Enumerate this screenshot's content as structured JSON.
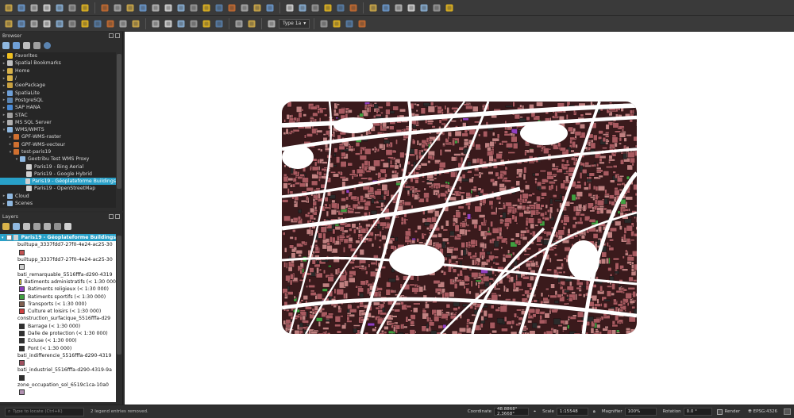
{
  "browser": {
    "title": "Browser",
    "items": [
      {
        "label": "Favorites",
        "depth": 0,
        "icon": "star-icon",
        "color": "#f0c020"
      },
      {
        "label": "Spatial Bookmarks",
        "depth": 0,
        "icon": "bookmark-icon",
        "color": "#c0c0c0"
      },
      {
        "label": "Home",
        "depth": 0,
        "icon": "folder-icon",
        "color": "#d8b24a"
      },
      {
        "label": "/",
        "depth": 0,
        "icon": "folder-icon",
        "color": "#d8b24a"
      },
      {
        "label": "GeoPackage",
        "depth": 0,
        "icon": "geopackage-icon",
        "color": "#c8a040"
      },
      {
        "label": "SpatiaLite",
        "depth": 0,
        "icon": "spatialite-icon",
        "color": "#6fa0d8"
      },
      {
        "label": "PostgreSQL",
        "depth": 0,
        "icon": "postgresql-icon",
        "color": "#5b84b1"
      },
      {
        "label": "SAP HANA",
        "depth": 0,
        "icon": "saphana-icon",
        "color": "#4a8ad4"
      },
      {
        "label": "STAC",
        "depth": 0,
        "icon": "stac-icon",
        "color": "#a0a0a0"
      },
      {
        "label": "MS SQL Server",
        "depth": 0,
        "icon": "mssql-icon",
        "color": "#b0b0b0"
      },
      {
        "label": "WMS/WMTS",
        "depth": 0,
        "icon": "globe-icon",
        "color": "#8fb8e0",
        "expanded": true
      },
      {
        "label": "GPF-WMS-raster",
        "depth": 1,
        "icon": "wms-icon",
        "color": "#d07030"
      },
      {
        "label": "GPF-WMS-vecteur",
        "depth": 1,
        "icon": "wms-icon",
        "color": "#d07030"
      },
      {
        "label": "test-paris19",
        "depth": 1,
        "icon": "wms-icon",
        "color": "#d07030",
        "expanded": true
      },
      {
        "label": "Geotribu Test WMS Proxy",
        "depth": 2,
        "icon": "globe-icon",
        "color": "#8fb8e0",
        "expanded": true
      },
      {
        "label": "Paris19 - Bing Aerial",
        "depth": 3,
        "icon": "grid-layer-icon",
        "color": "#d0d0d0"
      },
      {
        "label": "Paris19 - Google Hybrid",
        "depth": 3,
        "icon": "grid-layer-icon",
        "color": "#d0d0d0"
      },
      {
        "label": "Paris19 - Géoplateforme Buildings",
        "depth": 3,
        "icon": "grid-layer-icon",
        "color": "#d0d0d0",
        "selected": true
      },
      {
        "label": "Paris19 - OpenStreetMap",
        "depth": 3,
        "icon": "grid-layer-icon",
        "color": "#d0d0d0"
      },
      {
        "label": "Cloud",
        "depth": 0,
        "icon": "cloud-icon",
        "color": "#8fb8e0"
      },
      {
        "label": "Scenes",
        "depth": 0,
        "icon": "scenes-icon",
        "color": "#8fb8e0"
      }
    ]
  },
  "layers": {
    "title": "Layers",
    "top_layer": "Paris19 - Géoplateforme Buildings",
    "rows": [
      {
        "label": "builtupa_3337fdd7-27f0-4e24-ac25-30",
        "swatch": null
      },
      {
        "label": "",
        "swatch": "#c05050"
      },
      {
        "label": "builtupp_3337fdd7-27f0-4e24-ac25-30",
        "swatch": null
      },
      {
        "label": "",
        "swatch": "#d0d0d0"
      },
      {
        "label": "bati_remarquable_5516fffa-d290-4319",
        "swatch": null
      },
      {
        "label": "Batiments administratifs (< 1:30 000",
        "swatch": "#f0e040"
      },
      {
        "label": "Batiments religieux (< 1:30 000)",
        "swatch": "#9040c0"
      },
      {
        "label": "Batiments sportifs (< 1:30 000)",
        "swatch": "#40a040"
      },
      {
        "label": "Transports (< 1:30 000)",
        "swatch": "#806050"
      },
      {
        "label": "Culture et loisirs (< 1:30 000)",
        "swatch": "#d04040"
      },
      {
        "label": "construction_surfacique_5516fffa-d29",
        "swatch": null
      },
      {
        "label": "Barrage (< 1:30 000)",
        "swatch": "#303030"
      },
      {
        "label": "Dalle de protection (< 1:30 000)",
        "swatch": "#303030"
      },
      {
        "label": "Ecluse (< 1:30 000)",
        "swatch": "#303030"
      },
      {
        "label": "Pont (< 1:30 000)",
        "swatch": "#303030"
      },
      {
        "label": "bati_indifferencie_5516fffa-d290-4319",
        "swatch": null
      },
      {
        "label": "",
        "swatch": "#a05060"
      },
      {
        "label": "bati_industriel_5516fffa-d290-4319-9a",
        "swatch": null
      },
      {
        "label": "",
        "swatch": "#303030"
      },
      {
        "label": "zone_occupation_sol_6519c1ca-10a0",
        "swatch": null
      },
      {
        "label": "",
        "swatch": "#b090b0"
      }
    ]
  },
  "toolbar": {
    "type_combo": "Type 1a"
  },
  "status": {
    "locator_placeholder": "Type to locate (Ctrl+K)",
    "message": "2 legend entries removed.",
    "coordinate_label": "Coordinate",
    "coordinate_value": "48.8868° 2.3668°",
    "scale_label": "Scale",
    "scale_value": "1:15548",
    "magnifier_label": "Magnifier",
    "magnifier_value": "100%",
    "rotation_label": "Rotation",
    "rotation_value": "0.0 °",
    "render_label": "Render",
    "crs_label": "EPSG:4326"
  },
  "colors": {
    "accent": "#28a0c8",
    "building": "#a85a60",
    "industrial": "#2a2a2a",
    "sport": "#40a040",
    "religious": "#9040c0"
  }
}
